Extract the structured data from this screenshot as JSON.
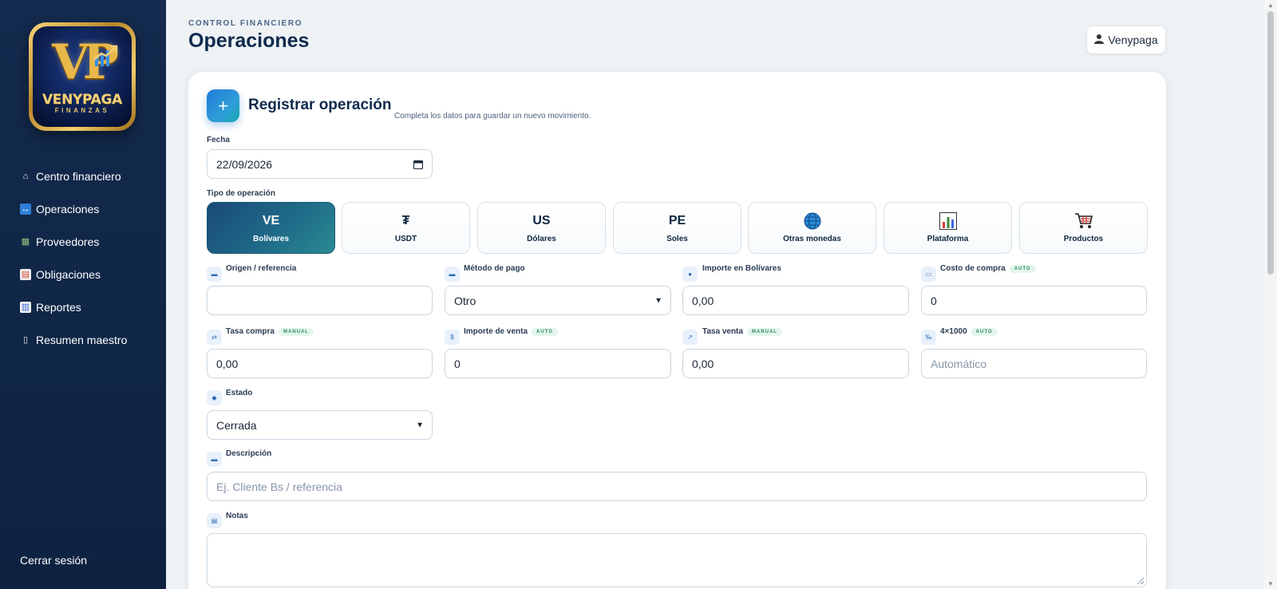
{
  "sidebar": {
    "logo": {
      "monogram": "VP",
      "brand": "VENYPAGA",
      "sub": "FINANZAS"
    },
    "items": [
      {
        "label": "Centro financiero",
        "icon": "home-icon",
        "glyph": "⌂",
        "color": "transparent"
      },
      {
        "label": "Operaciones",
        "icon": "swap-arrows-icon",
        "glyph": "↔",
        "color": "#2f7fd8"
      },
      {
        "label": "Proveedores",
        "icon": "buildings-icon",
        "glyph": "▦",
        "color": "#5a9a4a"
      },
      {
        "label": "Obligaciones",
        "icon": "calendar-icon",
        "glyph": "▤",
        "color": "#d84a3a"
      },
      {
        "label": "Reportes",
        "icon": "bar-chart-icon",
        "glyph": "▥",
        "color": "#3a6ad8"
      },
      {
        "label": "Resumen maestro",
        "icon": "document-icon",
        "glyph": "▯",
        "color": "#c8ced6"
      }
    ],
    "logout": "Cerrar sesión"
  },
  "header": {
    "eyebrow": "CONTROL FINANCIERO",
    "title": "Operaciones",
    "user": "Venypaga"
  },
  "form": {
    "title": "Registrar operación",
    "subtitle": "Completa los datos para guardar un nuevo movimiento.",
    "plus": "+",
    "date_label": "Fecha",
    "date_value": "22/09/2026",
    "type_label": "Tipo de operación",
    "types": [
      {
        "glyph": "VE",
        "label": "Bolívares",
        "active": true
      },
      {
        "glyph": "₮",
        "label": "USDT",
        "active": false
      },
      {
        "glyph": "US",
        "label": "Dólares",
        "active": false
      },
      {
        "glyph": "PE",
        "label": "Soles",
        "active": false
      },
      {
        "glyph": "🌐",
        "label": "Otras monedas",
        "active": false
      },
      {
        "glyph": "📊",
        "label": "Plataforma",
        "active": false
      },
      {
        "glyph": "🛒",
        "label": "Productos",
        "active": false
      }
    ],
    "origen_label": "Origen / referencia",
    "origen_value": "",
    "metodo_label": "Método de pago",
    "metodo_value": "Otro",
    "importe_bs_label": "Importe en Bolívares",
    "importe_bs_value": "0,00",
    "costo_label": "Costo de compra",
    "costo_badge": "AUTO",
    "costo_value": "0",
    "tasa_compra_label": "Tasa compra",
    "tasa_compra_badge": "MANUAL",
    "tasa_compra_value": "0,00",
    "importe_venta_label": "Importe de venta",
    "importe_venta_badge": "AUTO",
    "importe_venta_value": "0",
    "tasa_venta_label": "Tasa venta",
    "tasa_venta_badge": "MANUAL",
    "tasa_venta_value": "0,00",
    "impuesto_label": "4×1000",
    "impuesto_badge": "AUTO",
    "impuesto_placeholder": "Automático",
    "estado_label": "Estado",
    "estado_value": "Cerrada",
    "descripcion_label": "Descripción",
    "descripcion_placeholder": "Ej. Cliente Bs / referencia",
    "notas_label": "Notas"
  },
  "colors": {
    "sidebar": "#122a4c",
    "accent": "#1f7ad8",
    "active_tile": "#1f6a88"
  }
}
